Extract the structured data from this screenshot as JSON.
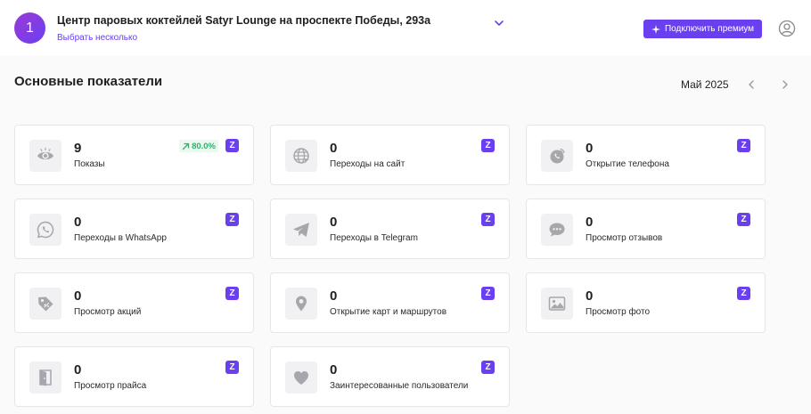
{
  "header": {
    "badge_number": "1",
    "venue_title": "Центр паровых коктейлей Satyr Lounge на проспекте Победы, 293а",
    "select_many": "Выбрать несколько",
    "premium_button": "Подключить премиум",
    "icons": {
      "dropdown": "chevron-down-icon",
      "premium": "sparkle-icon",
      "profile": "user-circle-icon"
    }
  },
  "section": {
    "title": "Основные показатели",
    "month": "Май 2025",
    "icons": {
      "prev": "chevron-left-icon",
      "next": "chevron-right-icon"
    }
  },
  "colors": {
    "accent": "#6a3ff0",
    "trend_up": "#2db36b"
  },
  "metrics": [
    {
      "value": "9",
      "label": "Показы",
      "icon": "eye-icon",
      "badge": "Z",
      "trend": "80.0%",
      "trend_icon": "arrow-up-right-icon"
    },
    {
      "value": "0",
      "label": "Переходы на сайт",
      "icon": "globe-icon",
      "badge": "Z"
    },
    {
      "value": "0",
      "label": "Открытие телефона",
      "icon": "phone-icon",
      "badge": "Z"
    },
    {
      "value": "0",
      "label": "Переходы в WhatsApp",
      "icon": "whatsapp-icon",
      "badge": "Z"
    },
    {
      "value": "0",
      "label": "Переходы в Telegram",
      "icon": "telegram-icon",
      "badge": "Z"
    },
    {
      "value": "0",
      "label": "Просмотр отзывов",
      "icon": "chat-bubble-icon",
      "badge": "Z"
    },
    {
      "value": "0",
      "label": "Просмотр акций",
      "icon": "tag-icon",
      "badge": "Z"
    },
    {
      "value": "0",
      "label": "Открытие карт и маршрутов",
      "icon": "map-pin-icon",
      "badge": "Z"
    },
    {
      "value": "0",
      "label": "Просмотр фото",
      "icon": "image-icon",
      "badge": "Z"
    },
    {
      "value": "0",
      "label": "Просмотр прайса",
      "icon": "price-list-icon",
      "badge": "Z"
    },
    {
      "value": "0",
      "label": "Заинтересованные пользователи",
      "icon": "heart-icon",
      "badge": "Z"
    }
  ]
}
